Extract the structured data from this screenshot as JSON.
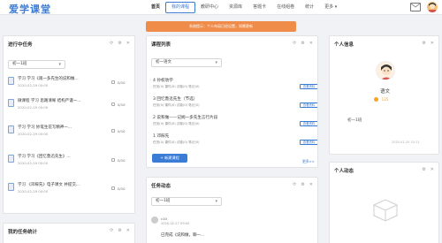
{
  "app": {
    "title": "爱学课堂"
  },
  "nav": {
    "items": [
      {
        "label": "首页"
      },
      {
        "label": "我的课程"
      },
      {
        "label": "教研中心"
      },
      {
        "label": "资源库"
      },
      {
        "label": "答题卡"
      },
      {
        "label": "在线组卷"
      },
      {
        "label": "统计"
      },
      {
        "label": "更多 ▾"
      }
    ]
  },
  "toast": {
    "text": "系统提示：个人布局已经设置，如需更新"
  },
  "tasks_card": {
    "title": "进行中任务",
    "filter_value": "初一1班",
    "items": [
      {
        "title": "学习 学习《观一多先生的说和做...",
        "date": "2020-02-29 00:00",
        "count": "0/10"
      },
      {
        "title": "微课程 学习 思路清晰 结构严谨一...",
        "date": "2020-02-29 00:00",
        "count": "0/10"
      },
      {
        "title": "学习 学习 妙笔生花写精神一...",
        "date": "2020-02-29 00:00",
        "count": "0/10"
      },
      {
        "title": "学习 学习《回忆鲁迅先生》...",
        "date": "2020-02-29 00:00",
        "count": "0/10"
      },
      {
        "title": "学习 《邓稼先》电子课文 并提交...",
        "date": "2020-02-29 00:00",
        "count": "0/10"
      }
    ]
  },
  "stats_card": {
    "title": "我的任务统计"
  },
  "course_card": {
    "title": "课程列表",
    "filter_value": "初一语文",
    "items": [
      {
        "title": "4 孙权劝学",
        "meta": "任务(0)   课件(0)   试卷(0)   笔记(0)",
        "button": "查看资料"
      },
      {
        "title": "3 回忆鲁迅先生（节选）",
        "meta": "任务(0)   课件(0)   试卷(0)   笔记(0)",
        "button": "查看资料"
      },
      {
        "title": "2 说和做——记闻一多先生言行片段",
        "meta": "任务(0)   课件(0)   试卷(0)   笔记(0)",
        "button": "查看资料"
      },
      {
        "title": "1 邓稼先",
        "meta": "任务(0)   课件(0)   试卷(0)   笔记(0)",
        "button": "查看资料"
      }
    ],
    "add_button": "+ 新建课程",
    "more": "更多>>"
  },
  "dynamic_card": {
    "title": "任务动态",
    "filter_value": "初一1班",
    "entry": {
      "count": "c10",
      "date": "2020-02-27 09:00",
      "text": "已完成《说和做，聊一..."
    }
  },
  "profile_card": {
    "title": "个人信息",
    "name": "语文",
    "coins": "135",
    "class": "初一1班",
    "date": "2020-01-20 10:11"
  },
  "activity_card": {
    "title": "个人动态"
  },
  "colors": {
    "accent": "#3a7bd5",
    "toast": "#f08c4a",
    "coin": "#f5a623"
  }
}
